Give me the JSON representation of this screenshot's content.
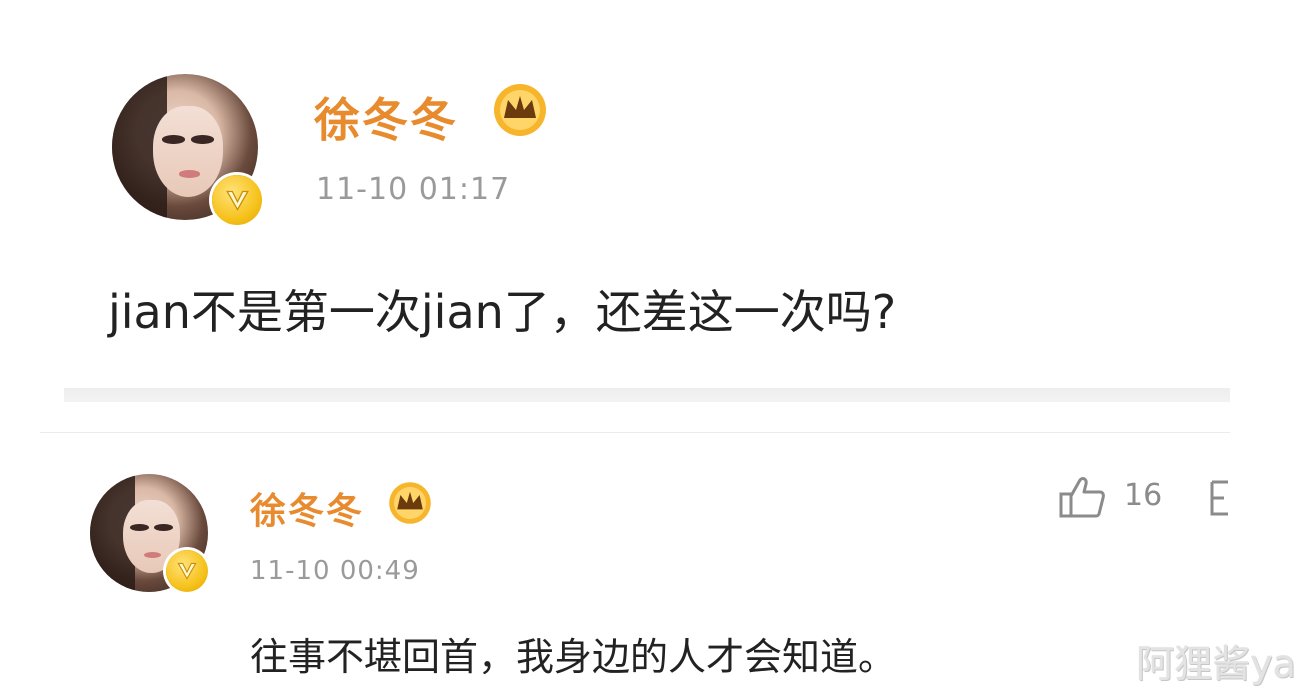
{
  "post": {
    "username": "徐冬冬",
    "time": "11-10 01:17",
    "text": "jian不是第一次jian了，还差这一次吗?"
  },
  "comment": {
    "username": "徐冬冬",
    "time": "11-10 00:49",
    "text": "往事不堪回首，我身边的人才会知道。",
    "likes": "16"
  },
  "watermark": "阿狸酱ya",
  "colors": {
    "username": "#e88a2e",
    "time": "#9a9a9a",
    "badge": "#f6c21c"
  }
}
